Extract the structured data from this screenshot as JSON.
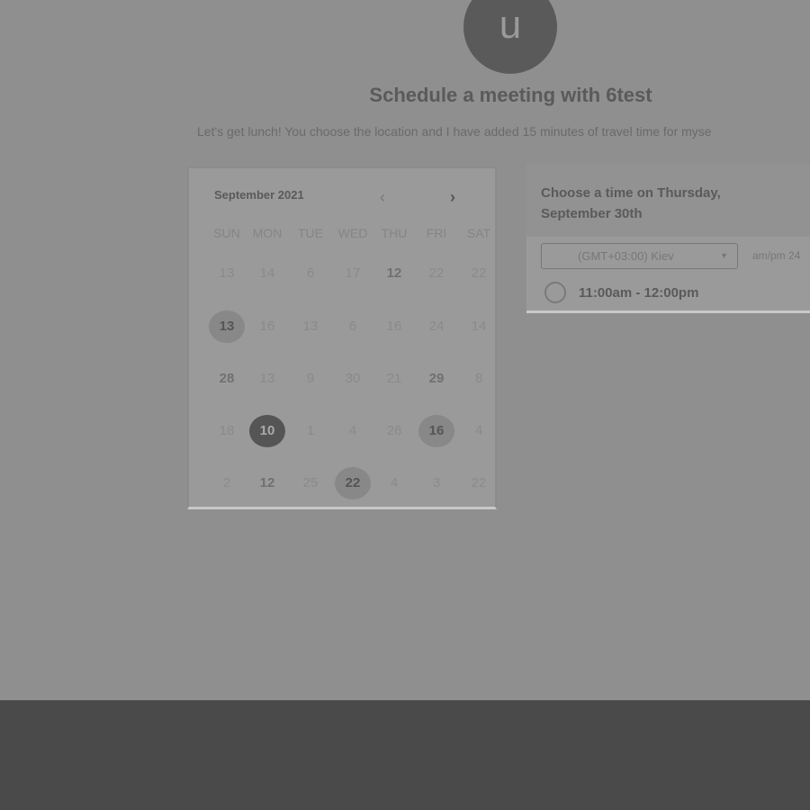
{
  "header": {
    "avatar_letter": "u",
    "title": "Schedule a meeting with 6test",
    "description": "Let's get lunch! You choose the location and I have added 15 minutes of travel time for myse"
  },
  "calendar": {
    "month": "September 2021",
    "prev_icon": "‹",
    "next_icon": "›",
    "weekdays": [
      "SUN",
      "MON",
      "TUE",
      "WED",
      "THU",
      "FRI",
      "SAT"
    ],
    "weeks": [
      [
        {
          "d": "13"
        },
        {
          "d": "14"
        },
        {
          "d": "6"
        },
        {
          "d": "17"
        },
        {
          "d": "12",
          "s": "avail"
        },
        {
          "d": "22"
        },
        {
          "d": "22"
        }
      ],
      [
        {
          "d": "13",
          "s": "light"
        },
        {
          "d": "16"
        },
        {
          "d": "13"
        },
        {
          "d": "6"
        },
        {
          "d": "16"
        },
        {
          "d": "24"
        },
        {
          "d": "14"
        }
      ],
      [
        {
          "d": "28",
          "s": "avail"
        },
        {
          "d": "13"
        },
        {
          "d": "9"
        },
        {
          "d": "30"
        },
        {
          "d": "21"
        },
        {
          "d": "29",
          "s": "avail"
        },
        {
          "d": "8"
        }
      ],
      [
        {
          "d": "18"
        },
        {
          "d": "10",
          "s": "sel"
        },
        {
          "d": "1"
        },
        {
          "d": "4"
        },
        {
          "d": "26"
        },
        {
          "d": "16",
          "s": "light"
        },
        {
          "d": "4"
        }
      ],
      [
        {
          "d": "2"
        },
        {
          "d": "12",
          "s": "avail"
        },
        {
          "d": "25"
        },
        {
          "d": "22",
          "s": "light"
        },
        {
          "d": "4"
        },
        {
          "d": "3"
        },
        {
          "d": "22"
        }
      ]
    ]
  },
  "times": {
    "title": "Choose a time on Thursday, September 30th",
    "timezone": "(GMT+03:00) Kiev",
    "format": "am/pm  24",
    "slots": [
      "11:00am - 12:00pm"
    ]
  }
}
